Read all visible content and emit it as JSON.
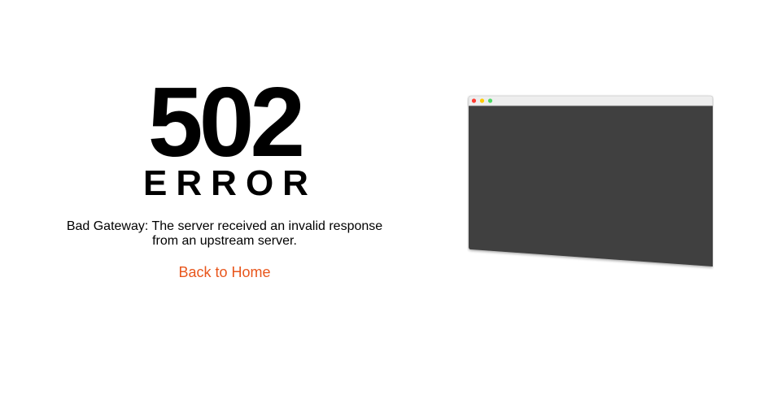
{
  "error": {
    "code": "502",
    "word": "ERROR",
    "message": "Bad Gateway: The server received an invalid response from an upstream server.",
    "home_link": "Back to Home"
  },
  "colors": {
    "link": "#e8561c",
    "window_body": "#404040",
    "dot_red": "#ff3b30",
    "dot_yellow": "#ffcc00",
    "dot_green": "#4cd964"
  },
  "icons": {
    "illustration": "browser-window-icon"
  }
}
